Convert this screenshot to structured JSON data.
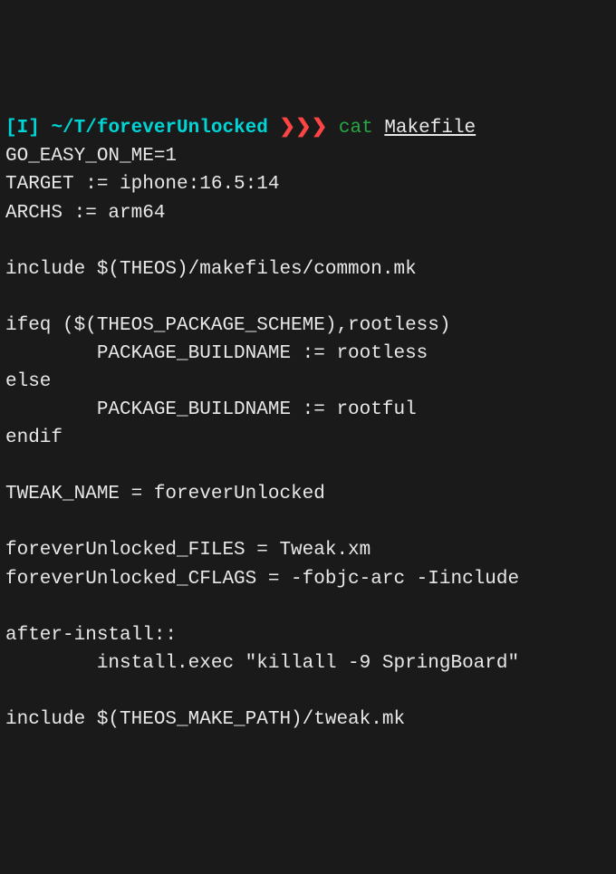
{
  "prompt": {
    "mode_open": "[",
    "mode_letter": "I",
    "mode_close": "]",
    "path": "~/T/foreverUnlocked",
    "arrows": "❯❯❯",
    "command": "cat",
    "argument": "Makefile"
  },
  "file": {
    "line1": "GO_EASY_ON_ME=1",
    "line2": "TARGET := iphone:16.5:14",
    "line3": "ARCHS := arm64",
    "line4": "",
    "line5": "include $(THEOS)/makefiles/common.mk",
    "line6": "",
    "line7": "ifeq ($(THEOS_PACKAGE_SCHEME),rootless)",
    "line8": "        PACKAGE_BUILDNAME := rootless",
    "line9": "else",
    "line10": "        PACKAGE_BUILDNAME := rootful",
    "line11": "endif",
    "line12": "",
    "line13": "TWEAK_NAME = foreverUnlocked",
    "line14": "",
    "line15": "foreverUnlocked_FILES = Tweak.xm",
    "line16": "foreverUnlocked_CFLAGS = -fobjc-arc -Iinclude",
    "line17": "",
    "line18": "after-install::",
    "line19": "        install.exec \"killall -9 SpringBoard\"",
    "line20": "",
    "line21": "include $(THEOS_MAKE_PATH)/tweak.mk"
  }
}
